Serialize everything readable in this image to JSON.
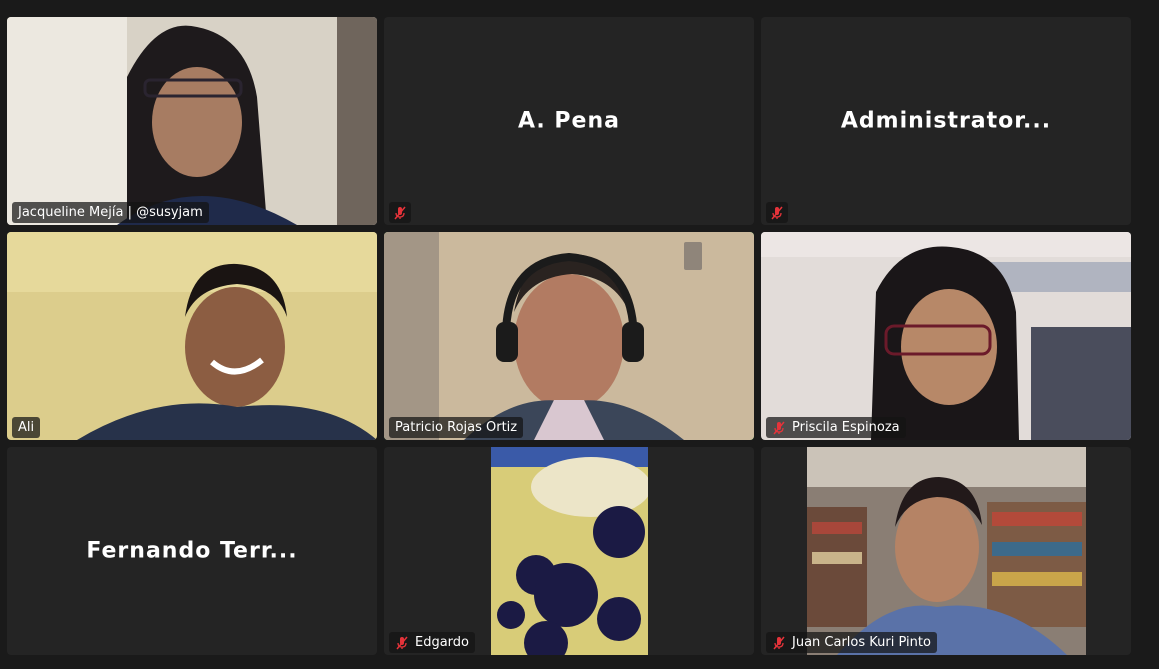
{
  "participants": [
    {
      "name": "Jacqueline Mejía | @susyjam",
      "muted": false,
      "video": true,
      "video_bg": "#d9d3c8"
    },
    {
      "name": "A. Pena",
      "muted": true,
      "video": false
    },
    {
      "name": "Administrator...",
      "muted": true,
      "video": false
    },
    {
      "name": "Ali",
      "muted": false,
      "video": true,
      "video_bg": "#d8c98a"
    },
    {
      "name": "Patricio Rojas Ortiz",
      "muted": false,
      "video": true,
      "active_speaker": true,
      "video_bg": "#cdbda3"
    },
    {
      "name": "Priscila Espinoza",
      "muted": true,
      "video": true,
      "video_bg": "#ddd8d6"
    },
    {
      "name": "Fernando Terr...",
      "muted": false,
      "video": false
    },
    {
      "name": "Edgardo",
      "muted": true,
      "video": true,
      "video_bg": "#d9cd7a"
    },
    {
      "name": "Juan Carlos Kuri Pinto",
      "muted": true,
      "video": true,
      "video_bg": "#8a7f78"
    }
  ],
  "colors": {
    "active_speaker_border": "#2fd55a",
    "mute_icon": "#e5333a",
    "tile_bg": "#242424",
    "page_bg": "#1a1a1a"
  }
}
